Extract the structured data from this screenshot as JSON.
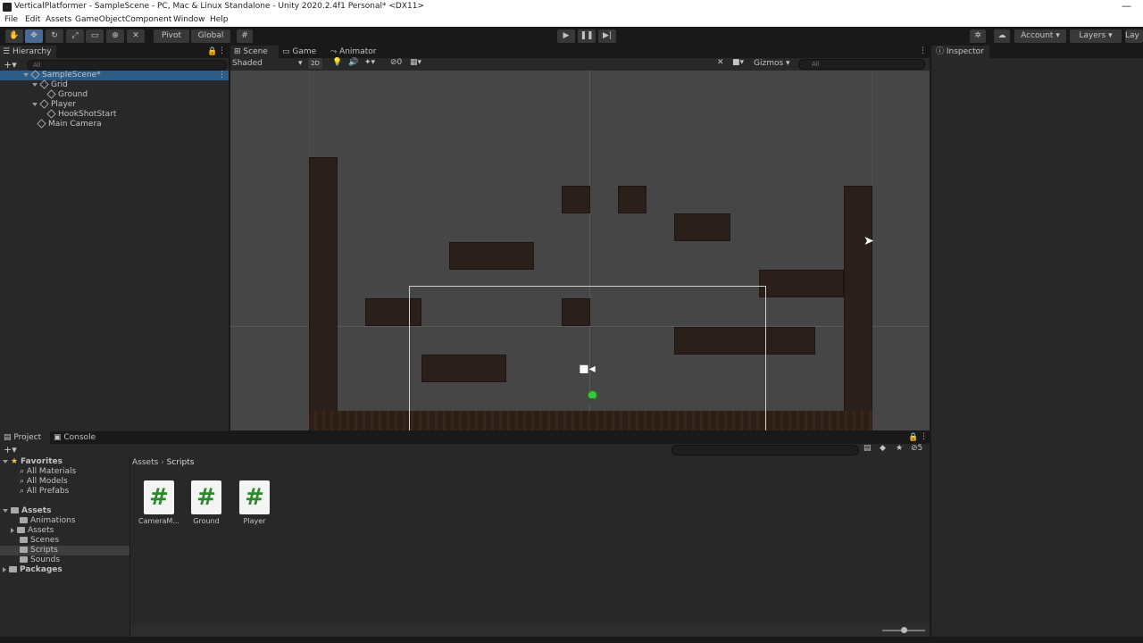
{
  "window": {
    "title": "VerticalPlatformer - SampleScene - PC, Mac & Linux Standalone - Unity 2020.2.4f1 Personal* <DX11>"
  },
  "menu": [
    "File",
    "Edit",
    "Assets",
    "GameObject",
    "Component",
    "Window",
    "Help"
  ],
  "toolbar": {
    "pivot_label": "Pivot",
    "global_label": "Global",
    "account_label": "Account",
    "layers_label": "Layers",
    "layout_label": "Lay"
  },
  "hierarchy": {
    "tab": "Hierarchy",
    "search_placeholder": "All",
    "items": [
      {
        "label": "SampleScene*",
        "depth": 0
      },
      {
        "label": "Grid",
        "depth": 1
      },
      {
        "label": "Ground",
        "depth": 2
      },
      {
        "label": "Player",
        "depth": 1
      },
      {
        "label": "HookShotStart",
        "depth": 2
      },
      {
        "label": "Main Camera",
        "depth": 1
      }
    ]
  },
  "scene": {
    "tabs": [
      "Scene",
      "Game",
      "Animator"
    ],
    "shading_mode": "Shaded",
    "mode_2d": "2D",
    "gizmos_label": "Gizmos",
    "search_placeholder": "All",
    "hidden_count": "0"
  },
  "inspector": {
    "tab": "Inspector"
  },
  "project": {
    "tabs": [
      "Project",
      "Console"
    ],
    "favorites": {
      "label": "Favorites",
      "items": [
        "All Materials",
        "All Models",
        "All Prefabs"
      ]
    },
    "assets": {
      "label": "Assets",
      "items": [
        "Animations",
        "Assets",
        "Scenes",
        "Scripts",
        "Sounds"
      ]
    },
    "packages_label": "Packages",
    "breadcrumb": [
      "Assets",
      "Scripts"
    ],
    "files": [
      {
        "name": "CameraM...",
        "glyph": "#"
      },
      {
        "name": "Ground",
        "glyph": "#"
      },
      {
        "name": "Player",
        "glyph": "#"
      }
    ],
    "hidden_count": "5"
  },
  "colors": {
    "selection": "#2c5d87",
    "panel": "#282828",
    "scene_bg": "#464646",
    "tile": "#2a1f1a"
  }
}
